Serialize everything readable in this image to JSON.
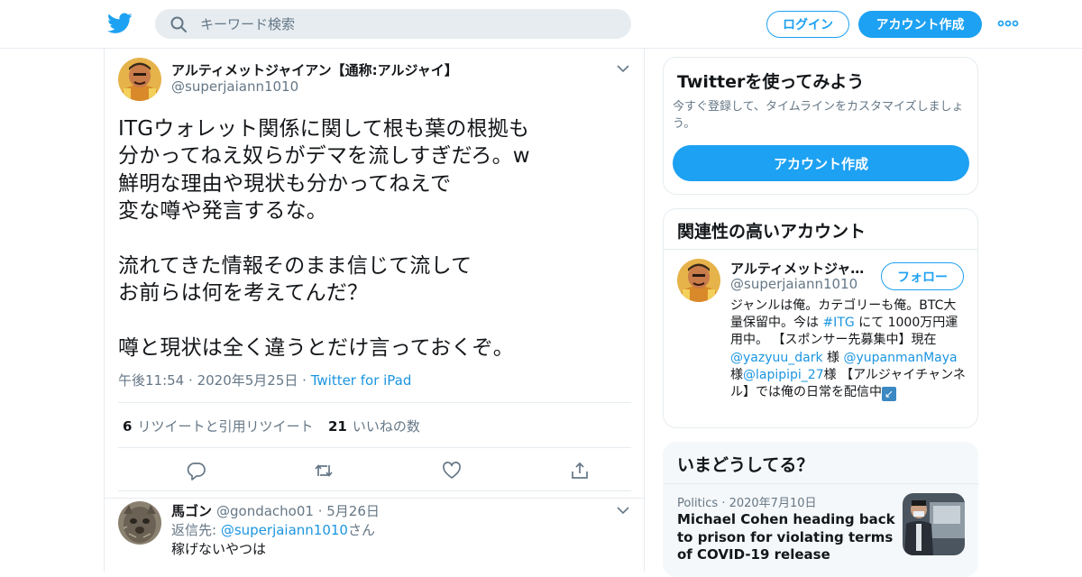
{
  "header": {
    "search_placeholder": "キーワード検索",
    "login": "ログイン",
    "signup": "アカウント作成",
    "brand_color": "#1da1f2"
  },
  "tweet": {
    "name": "アルティメットジャイアン【通称:アルジャイ】",
    "handle": "@superjaiann1010",
    "text": "ITGウォレット関係に関して根も葉の根拠も\n分かってねえ奴らがデマを流しすぎだろ。w\n鮮明な理由や現状も分かってねえで\n変な噂や発言するな。\n\n流れてきた情報そのまま信じて流して\nお前らは何を考えてんだ？\n\n噂と現状は全く違うとだけ言っておくぞ。",
    "time": "午後11:54",
    "date": "2020年5月25日",
    "source": "Twitter for iPad",
    "retweet_count": "6",
    "retweet_label": "リツイートと引用リツイート",
    "like_count": "21",
    "like_label": "いいねの数"
  },
  "reply": {
    "name": "馬ゴン",
    "handle": "@gondacho01",
    "date": "5月26日",
    "to_prefix": "返信先: ",
    "to_handle": "@superjaiann1010",
    "to_suffix": "さん",
    "text": "稼げないやつは"
  },
  "sidebar": {
    "signup_card": {
      "title": "Twitterを使ってみよう",
      "subtitle": "今すぐ登録して、タイムラインをカスタマイズしましょう。",
      "button": "アカウント作成"
    },
    "related": {
      "title": "関連性の高いアカウント",
      "name": "アルティメットジャイアン【通称:アルジャイ】",
      "handle": "@superjaiann1010",
      "follow": "フォロー",
      "bio_1": "ジャンルは俺。カテゴリーも俺。BTC大量保留中。今は ",
      "bio_hashtag": "#ITG",
      "bio_2": " にて 1000万円運用中。 【スポンサー先募集中】現在",
      "bio_m1": "@yazyuu_dark",
      "bio_3": " 様 ",
      "bio_m2": "@yupanmanMaya",
      "bio_4": "様",
      "bio_m3": "@lapipipi_27",
      "bio_5": "様 【アルジャイチャンネル】では俺の日常を配信中",
      "bio_emoji": "↙"
    },
    "trends": {
      "title": "いまどうしてる？",
      "category": "Politics",
      "date": "2020年7月10日",
      "headline": "Michael Cohen heading back to prison for violating terms of COVID-19 release"
    }
  }
}
